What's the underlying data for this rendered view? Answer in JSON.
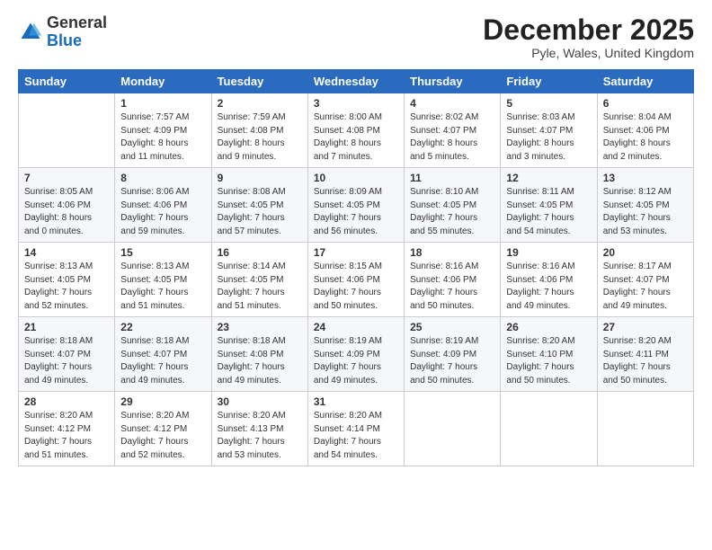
{
  "logo": {
    "general": "General",
    "blue": "Blue"
  },
  "header": {
    "month": "December 2025",
    "location": "Pyle, Wales, United Kingdom"
  },
  "days_of_week": [
    "Sunday",
    "Monday",
    "Tuesday",
    "Wednesday",
    "Thursday",
    "Friday",
    "Saturday"
  ],
  "weeks": [
    [
      {
        "day": "",
        "sunrise": "",
        "sunset": "",
        "daylight": ""
      },
      {
        "day": "1",
        "sunrise": "Sunrise: 7:57 AM",
        "sunset": "Sunset: 4:09 PM",
        "daylight": "Daylight: 8 hours and 11 minutes."
      },
      {
        "day": "2",
        "sunrise": "Sunrise: 7:59 AM",
        "sunset": "Sunset: 4:08 PM",
        "daylight": "Daylight: 8 hours and 9 minutes."
      },
      {
        "day": "3",
        "sunrise": "Sunrise: 8:00 AM",
        "sunset": "Sunset: 4:08 PM",
        "daylight": "Daylight: 8 hours and 7 minutes."
      },
      {
        "day": "4",
        "sunrise": "Sunrise: 8:02 AM",
        "sunset": "Sunset: 4:07 PM",
        "daylight": "Daylight: 8 hours and 5 minutes."
      },
      {
        "day": "5",
        "sunrise": "Sunrise: 8:03 AM",
        "sunset": "Sunset: 4:07 PM",
        "daylight": "Daylight: 8 hours and 3 minutes."
      },
      {
        "day": "6",
        "sunrise": "Sunrise: 8:04 AM",
        "sunset": "Sunset: 4:06 PM",
        "daylight": "Daylight: 8 hours and 2 minutes."
      }
    ],
    [
      {
        "day": "7",
        "sunrise": "Sunrise: 8:05 AM",
        "sunset": "Sunset: 4:06 PM",
        "daylight": "Daylight: 8 hours and 0 minutes."
      },
      {
        "day": "8",
        "sunrise": "Sunrise: 8:06 AM",
        "sunset": "Sunset: 4:06 PM",
        "daylight": "Daylight: 7 hours and 59 minutes."
      },
      {
        "day": "9",
        "sunrise": "Sunrise: 8:08 AM",
        "sunset": "Sunset: 4:05 PM",
        "daylight": "Daylight: 7 hours and 57 minutes."
      },
      {
        "day": "10",
        "sunrise": "Sunrise: 8:09 AM",
        "sunset": "Sunset: 4:05 PM",
        "daylight": "Daylight: 7 hours and 56 minutes."
      },
      {
        "day": "11",
        "sunrise": "Sunrise: 8:10 AM",
        "sunset": "Sunset: 4:05 PM",
        "daylight": "Daylight: 7 hours and 55 minutes."
      },
      {
        "day": "12",
        "sunrise": "Sunrise: 8:11 AM",
        "sunset": "Sunset: 4:05 PM",
        "daylight": "Daylight: 7 hours and 54 minutes."
      },
      {
        "day": "13",
        "sunrise": "Sunrise: 8:12 AM",
        "sunset": "Sunset: 4:05 PM",
        "daylight": "Daylight: 7 hours and 53 minutes."
      }
    ],
    [
      {
        "day": "14",
        "sunrise": "Sunrise: 8:13 AM",
        "sunset": "Sunset: 4:05 PM",
        "daylight": "Daylight: 7 hours and 52 minutes."
      },
      {
        "day": "15",
        "sunrise": "Sunrise: 8:13 AM",
        "sunset": "Sunset: 4:05 PM",
        "daylight": "Daylight: 7 hours and 51 minutes."
      },
      {
        "day": "16",
        "sunrise": "Sunrise: 8:14 AM",
        "sunset": "Sunset: 4:05 PM",
        "daylight": "Daylight: 7 hours and 51 minutes."
      },
      {
        "day": "17",
        "sunrise": "Sunrise: 8:15 AM",
        "sunset": "Sunset: 4:06 PM",
        "daylight": "Daylight: 7 hours and 50 minutes."
      },
      {
        "day": "18",
        "sunrise": "Sunrise: 8:16 AM",
        "sunset": "Sunset: 4:06 PM",
        "daylight": "Daylight: 7 hours and 50 minutes."
      },
      {
        "day": "19",
        "sunrise": "Sunrise: 8:16 AM",
        "sunset": "Sunset: 4:06 PM",
        "daylight": "Daylight: 7 hours and 49 minutes."
      },
      {
        "day": "20",
        "sunrise": "Sunrise: 8:17 AM",
        "sunset": "Sunset: 4:07 PM",
        "daylight": "Daylight: 7 hours and 49 minutes."
      }
    ],
    [
      {
        "day": "21",
        "sunrise": "Sunrise: 8:18 AM",
        "sunset": "Sunset: 4:07 PM",
        "daylight": "Daylight: 7 hours and 49 minutes."
      },
      {
        "day": "22",
        "sunrise": "Sunrise: 8:18 AM",
        "sunset": "Sunset: 4:07 PM",
        "daylight": "Daylight: 7 hours and 49 minutes."
      },
      {
        "day": "23",
        "sunrise": "Sunrise: 8:18 AM",
        "sunset": "Sunset: 4:08 PM",
        "daylight": "Daylight: 7 hours and 49 minutes."
      },
      {
        "day": "24",
        "sunrise": "Sunrise: 8:19 AM",
        "sunset": "Sunset: 4:09 PM",
        "daylight": "Daylight: 7 hours and 49 minutes."
      },
      {
        "day": "25",
        "sunrise": "Sunrise: 8:19 AM",
        "sunset": "Sunset: 4:09 PM",
        "daylight": "Daylight: 7 hours and 50 minutes."
      },
      {
        "day": "26",
        "sunrise": "Sunrise: 8:20 AM",
        "sunset": "Sunset: 4:10 PM",
        "daylight": "Daylight: 7 hours and 50 minutes."
      },
      {
        "day": "27",
        "sunrise": "Sunrise: 8:20 AM",
        "sunset": "Sunset: 4:11 PM",
        "daylight": "Daylight: 7 hours and 50 minutes."
      }
    ],
    [
      {
        "day": "28",
        "sunrise": "Sunrise: 8:20 AM",
        "sunset": "Sunset: 4:12 PM",
        "daylight": "Daylight: 7 hours and 51 minutes."
      },
      {
        "day": "29",
        "sunrise": "Sunrise: 8:20 AM",
        "sunset": "Sunset: 4:12 PM",
        "daylight": "Daylight: 7 hours and 52 minutes."
      },
      {
        "day": "30",
        "sunrise": "Sunrise: 8:20 AM",
        "sunset": "Sunset: 4:13 PM",
        "daylight": "Daylight: 7 hours and 53 minutes."
      },
      {
        "day": "31",
        "sunrise": "Sunrise: 8:20 AM",
        "sunset": "Sunset: 4:14 PM",
        "daylight": "Daylight: 7 hours and 54 minutes."
      },
      {
        "day": "",
        "sunrise": "",
        "sunset": "",
        "daylight": ""
      },
      {
        "day": "",
        "sunrise": "",
        "sunset": "",
        "daylight": ""
      },
      {
        "day": "",
        "sunrise": "",
        "sunset": "",
        "daylight": ""
      }
    ]
  ]
}
